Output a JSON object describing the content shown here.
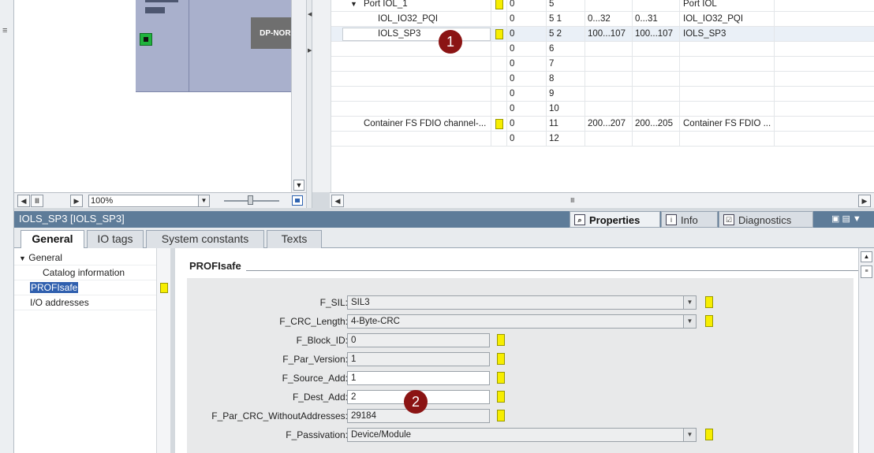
{
  "device_view": {
    "module_label": "DP-NORM",
    "zoom": "100%"
  },
  "table": {
    "rows": [
      {
        "name": "",
        "rack": "0",
        "slot": "5",
        "i_addr": "",
        "q_addr": "",
        "type": "Port IOL",
        "badge": true,
        "expander": "▼",
        "edit": false
      },
      {
        "name": "IOL_IO32_PQI",
        "rack": "0",
        "slot": "5 1",
        "i_addr": "0...32",
        "q_addr": "0...31",
        "type": "IOL_IO32_PQI",
        "badge": false,
        "edit": false
      },
      {
        "name": "IOLS_SP3",
        "rack": "0",
        "slot": "5 2",
        "i_addr": "100...107",
        "q_addr": "100...107",
        "type": "IOLS_SP3",
        "badge": true,
        "edit": true
      },
      {
        "name": "",
        "rack": "0",
        "slot": "6",
        "i_addr": "",
        "q_addr": "",
        "type": "",
        "badge": false
      },
      {
        "name": "",
        "rack": "0",
        "slot": "7",
        "i_addr": "",
        "q_addr": "",
        "type": "",
        "badge": false
      },
      {
        "name": "",
        "rack": "0",
        "slot": "8",
        "i_addr": "",
        "q_addr": "",
        "type": "",
        "badge": false
      },
      {
        "name": "",
        "rack": "0",
        "slot": "9",
        "i_addr": "",
        "q_addr": "",
        "type": "",
        "badge": false
      },
      {
        "name": "",
        "rack": "0",
        "slot": "10",
        "i_addr": "",
        "q_addr": "",
        "type": "",
        "badge": false
      },
      {
        "name": "Container FS FDIO channel-...",
        "rack": "0",
        "slot": "11",
        "i_addr": "200...207",
        "q_addr": "200...205",
        "type": "Container FS FDIO ...",
        "badge": true
      },
      {
        "name": "",
        "rack": "0",
        "slot": "12",
        "i_addr": "",
        "q_addr": "",
        "type": "",
        "badge": false
      }
    ],
    "port_row_name": "Port IOL_1"
  },
  "inspector": {
    "title": "IOLS_SP3 [IOLS_SP3]",
    "header_tabs": [
      {
        "label": "Properties",
        "icon": "properties-icon"
      },
      {
        "label": "Info",
        "icon": "info-icon"
      },
      {
        "label": "Diagnostics",
        "icon": "diagnostics-icon"
      }
    ],
    "sub_tabs": [
      "General",
      "IO tags",
      "System constants",
      "Texts"
    ]
  },
  "nav": {
    "items": [
      "General",
      "Catalog information",
      "PROFIsafe",
      "I/O addresses"
    ]
  },
  "content": {
    "heading": "PROFIsafe",
    "fields": [
      {
        "label": "F_SIL:",
        "value": "SIL3",
        "kind": "select"
      },
      {
        "label": "F_CRC_Length:",
        "value": "4-Byte-CRC",
        "kind": "select"
      },
      {
        "label": "F_Block_ID:",
        "value": "0",
        "kind": "input"
      },
      {
        "label": "F_Par_Version:",
        "value": "1",
        "kind": "input"
      },
      {
        "label": "F_Source_Add:",
        "value": "1",
        "kind": "input-white"
      },
      {
        "label": "F_Dest_Add:",
        "value": "2",
        "kind": "input-white"
      },
      {
        "label": "F_Par_CRC_WithoutAddresses:",
        "value": "29184",
        "kind": "input"
      },
      {
        "label": "F_Passivation:",
        "value": "Device/Module",
        "kind": "select"
      }
    ]
  },
  "callouts": [
    "1",
    "2"
  ],
  "colors": {
    "inspector_bar": "#5e7c99",
    "status_badge": "#f7ee00",
    "callout": "#8b1414",
    "selection": "#2f5fae"
  }
}
